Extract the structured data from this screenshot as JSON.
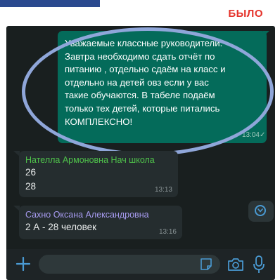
{
  "annotation": {
    "label": "БЫЛО",
    "label_color": "#e5332b",
    "highlight_color": "#8fa6d9"
  },
  "chat": {
    "outgoing_message": {
      "lines": [
        "Уважаемые классные руководители.",
        "Завтра необходимо сдать отчёт по",
        "питанию , отдельно сдаём на класс и",
        "отдельно на детей овз если у вас",
        "такие обучаются. В табеле подаём",
        "только тех детей, которые питались",
        "КОМПЛЕКСНО!"
      ],
      "time": "13:04",
      "status_icon": "double-check-icon",
      "bubble_color": "#046b5a"
    },
    "incoming_messages": [
      {
        "sender": "Нателла Армоновна Нач школа",
        "lines": [
          "26",
          "28"
        ],
        "time": "13:13",
        "sender_color": "#4fc24b"
      },
      {
        "sender": "Сахно Оксана Александровна",
        "lines": [
          "2 А - 28 человек"
        ],
        "time": "13:16",
        "sender_color": "#a79bf0"
      }
    ]
  },
  "composer": {
    "input_placeholder": "",
    "icons": [
      "plus-icon",
      "sticker-icon",
      "camera-icon",
      "microphone-icon"
    ]
  },
  "scroll_button_icon": "chevron-down-icon"
}
